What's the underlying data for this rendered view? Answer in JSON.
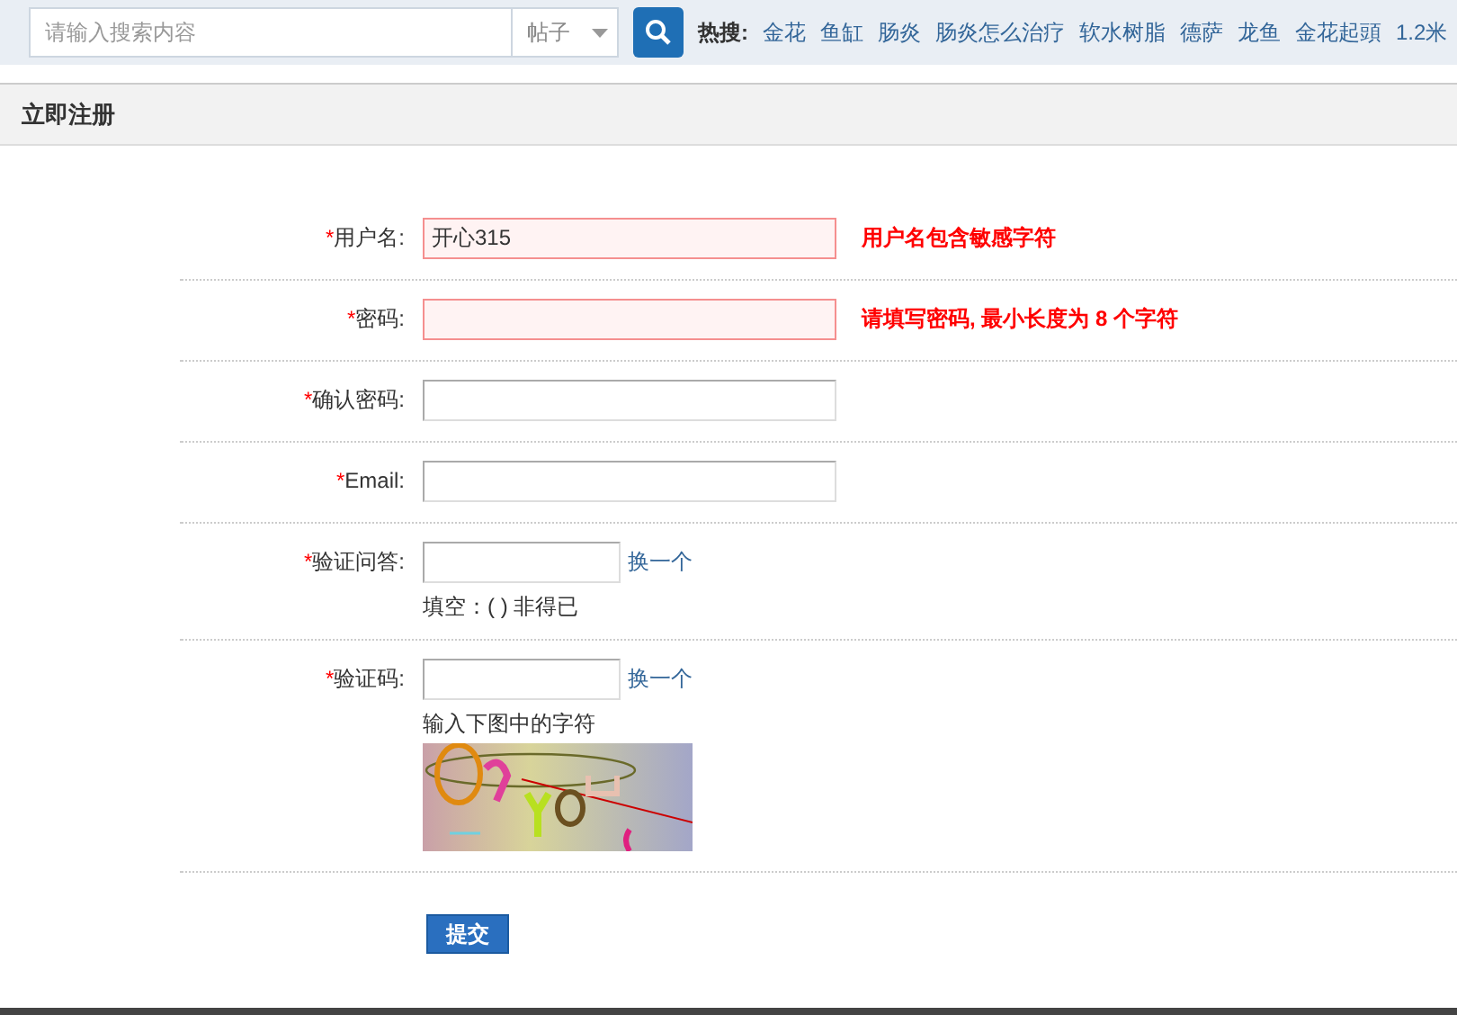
{
  "search": {
    "placeholder": "请输入搜索内容",
    "scope": "帖子"
  },
  "hot": {
    "label": "热搜:",
    "words": [
      "金花",
      "鱼缸",
      "肠炎",
      "肠炎怎么治疗",
      "软水树脂",
      "德萨",
      "龙鱼",
      "金花起頭",
      "1.2米"
    ]
  },
  "panel": {
    "title": "立即注册"
  },
  "rows": [
    {
      "kind": "field",
      "mark": "*",
      "label": "用户名:",
      "value": "开心315",
      "invalid": true,
      "error": "用户名包含敏感字符"
    },
    {
      "kind": "field",
      "mark": "*",
      "label": "密码:",
      "value": "",
      "invalid": true,
      "error": "请填写密码, 最小长度为 8 个字符"
    },
    {
      "kind": "field",
      "mark": "*",
      "label": "确认密码:",
      "value": "",
      "invalid": false
    },
    {
      "kind": "field",
      "mark": "*",
      "label": "Email:",
      "value": "",
      "invalid": false
    },
    {
      "kind": "qa",
      "mark": "*",
      "label": "验证问答:",
      "link": "换一个",
      "hint": "填空：(   ) 非得已"
    },
    {
      "kind": "captcha",
      "mark": "*",
      "label": "验证码:",
      "link": "换一个",
      "hint": "输入下图中的字符"
    }
  ],
  "submit": "提交"
}
